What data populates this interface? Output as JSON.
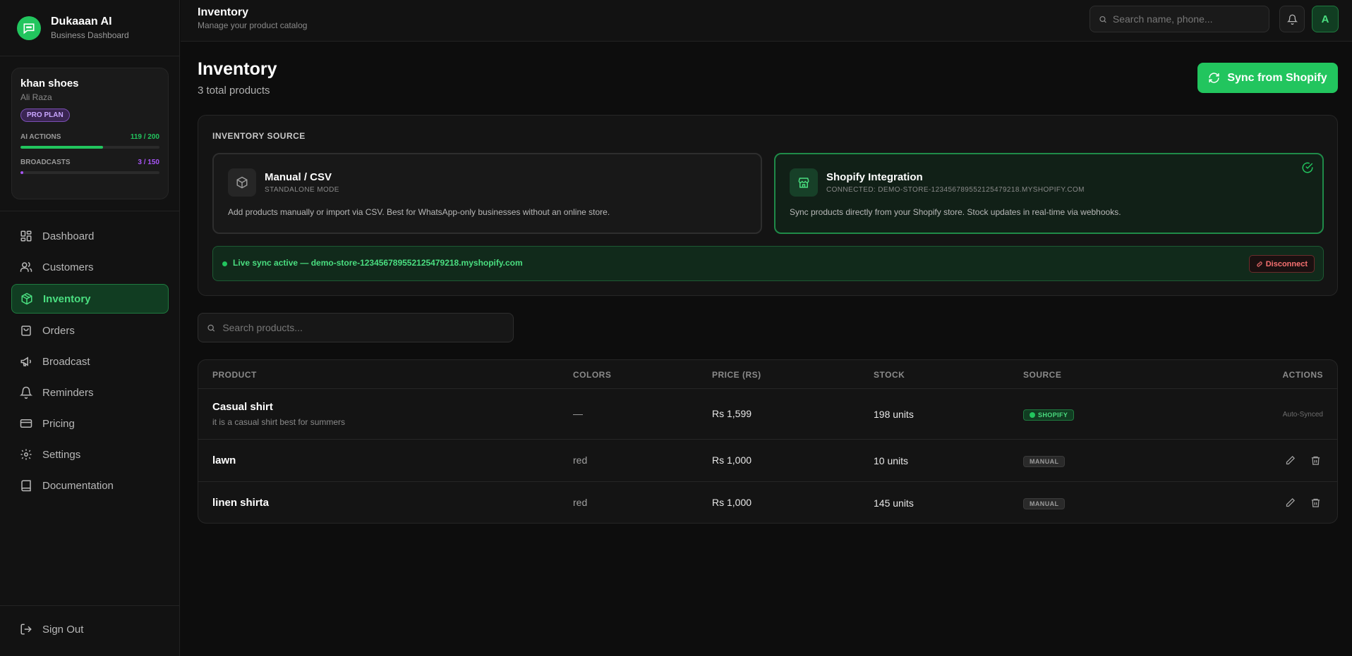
{
  "brand": {
    "title": "Dukaaan AI",
    "subtitle": "Business Dashboard"
  },
  "store": {
    "name": "khan shoes",
    "owner": "Ali Raza",
    "plan": "PRO PLAN",
    "ai_actions": {
      "label": "AI ACTIONS",
      "value": "119 / 200",
      "used": 119,
      "limit": 200,
      "color": "#22c55e"
    },
    "broadcasts": {
      "label": "BROADCASTS",
      "value": "3 / 150",
      "used": 3,
      "limit": 150,
      "color": "#a855f7"
    }
  },
  "nav": {
    "items": [
      {
        "label": "Dashboard",
        "icon": "dashboard-icon"
      },
      {
        "label": "Customers",
        "icon": "users-icon"
      },
      {
        "label": "Inventory",
        "icon": "box-icon",
        "active": true
      },
      {
        "label": "Orders",
        "icon": "shopping-bag-icon"
      },
      {
        "label": "Broadcast",
        "icon": "megaphone-icon"
      },
      {
        "label": "Reminders",
        "icon": "bell-icon"
      },
      {
        "label": "Pricing",
        "icon": "credit-card-icon"
      },
      {
        "label": "Settings",
        "icon": "gear-icon"
      },
      {
        "label": "Documentation",
        "icon": "book-icon"
      }
    ],
    "sign_out": "Sign Out"
  },
  "topbar": {
    "title": "Inventory",
    "subtitle": "Manage your product catalog",
    "search_placeholder": "Search name, phone...",
    "avatar_initial": "A"
  },
  "page": {
    "title": "Inventory",
    "subtitle": "3 total products",
    "sync_button": "Sync from Shopify"
  },
  "inventory_source": {
    "heading": "INVENTORY SOURCE",
    "manual": {
      "title": "Manual / CSV",
      "mode": "STANDALONE MODE",
      "description": "Add products manually or import via CSV. Best for WhatsApp-only businesses without an online store."
    },
    "shopify": {
      "title": "Shopify Integration",
      "mode": "CONNECTED: DEMO-STORE-123456789552125479218.MYSHOPIFY.COM",
      "description": "Sync products directly from your Shopify store. Stock updates in real-time via webhooks.",
      "selected": true
    },
    "live_status": "Live sync active — demo-store-123456789552125479218.myshopify.com",
    "disconnect_label": "Disconnect"
  },
  "product_search": {
    "placeholder": "Search products..."
  },
  "table": {
    "headers": {
      "product": "PRODUCT",
      "colors": "COLORS",
      "price": "PRICE (RS)",
      "stock": "STOCK",
      "source": "SOURCE",
      "actions": "ACTIONS"
    },
    "rows": [
      {
        "name": "Casual shirt",
        "description": "it is a casual shirt best for summers",
        "colors": "—",
        "price": "Rs 1,599",
        "stock": "198 units",
        "source": "SHOPIFY",
        "action_text": "Auto-Synced"
      },
      {
        "name": "lawn",
        "description": "",
        "colors": "red",
        "price": "Rs 1,000",
        "stock": "10 units",
        "source": "MANUAL"
      },
      {
        "name": "linen shirta",
        "description": "",
        "colors": "red",
        "price": "Rs 1,000",
        "stock": "145 units",
        "source": "MANUAL"
      }
    ]
  }
}
